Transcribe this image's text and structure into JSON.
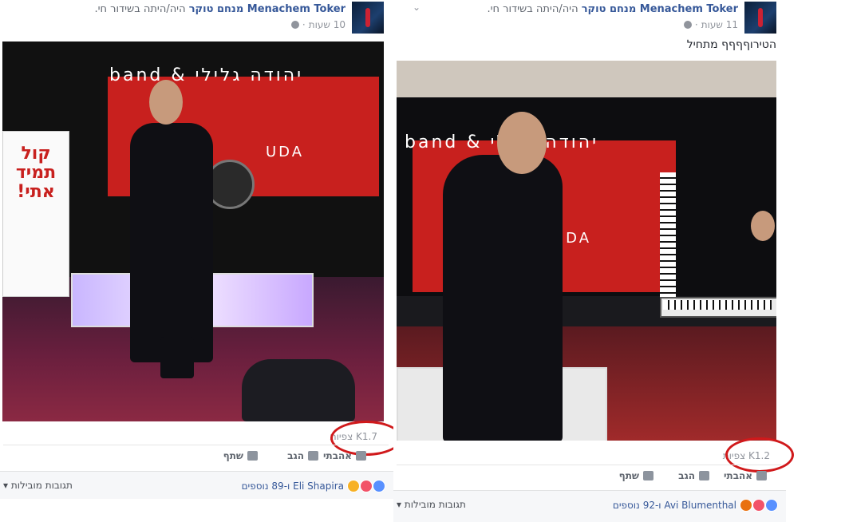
{
  "posts": [
    {
      "author": "Menachem Toker מנחם טוקר",
      "live_text": "היה/היתה בשידור חי.",
      "time": "10 שעות",
      "post_text": "",
      "video": {
        "banner": "band & יהודה גלילי",
        "banner_sub": "UDA",
        "sign": "קול\nתמיד\nאתי!"
      },
      "views": "K1.7 צפיות",
      "actions": {
        "like": "אהבתי",
        "comment": "הגב",
        "share": "שתף"
      },
      "reactions_text": "Eli Shapira ו-89 נוספים",
      "top_comments": "תגובות מובילות"
    },
    {
      "author": "Menachem Toker מנחם טוקר",
      "live_text": "היה/היתה בשידור חי.",
      "time": "11 שעות",
      "post_text": "הטירוףףףף מתחיל",
      "video": {
        "banner": "band & יהודה גלילי",
        "banner_sub": "UDA",
        "sign": ""
      },
      "views": "K1.2 צפיות",
      "actions": {
        "like": "אהבתי",
        "comment": "הגב",
        "share": "שתף"
      },
      "reactions_text": "Avi Blumenthal ו-92 נוספים",
      "top_comments": "תגובות מובילות"
    }
  ],
  "colors": {
    "author_link": "#365899",
    "meta_gray": "#90949c",
    "highlight_circle": "#d0191b",
    "banner_red": "#c8201e"
  },
  "icons": [
    "globe-icon",
    "chevron-down-icon",
    "like-icon",
    "comment-icon",
    "share-icon",
    "like-reaction-icon",
    "love-reaction-icon",
    "wow-reaction-icon",
    "angry-reaction-icon"
  ]
}
